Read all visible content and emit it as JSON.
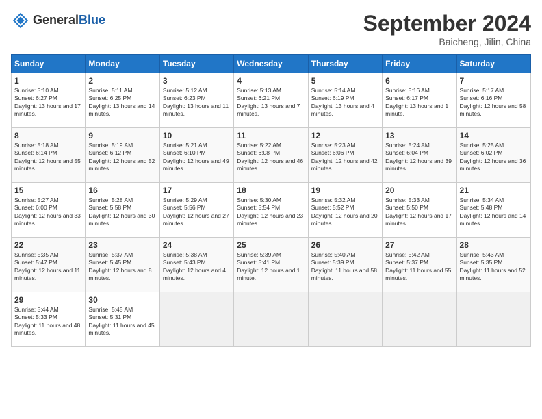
{
  "header": {
    "logo_general": "General",
    "logo_blue": "Blue",
    "month": "September 2024",
    "location": "Baicheng, Jilin, China"
  },
  "days_of_week": [
    "Sunday",
    "Monday",
    "Tuesday",
    "Wednesday",
    "Thursday",
    "Friday",
    "Saturday"
  ],
  "weeks": [
    [
      {
        "day": 1,
        "sunrise": "5:10 AM",
        "sunset": "6:27 PM",
        "daylight": "13 hours and 17 minutes."
      },
      {
        "day": 2,
        "sunrise": "5:11 AM",
        "sunset": "6:25 PM",
        "daylight": "13 hours and 14 minutes."
      },
      {
        "day": 3,
        "sunrise": "5:12 AM",
        "sunset": "6:23 PM",
        "daylight": "13 hours and 11 minutes."
      },
      {
        "day": 4,
        "sunrise": "5:13 AM",
        "sunset": "6:21 PM",
        "daylight": "13 hours and 7 minutes."
      },
      {
        "day": 5,
        "sunrise": "5:14 AM",
        "sunset": "6:19 PM",
        "daylight": "13 hours and 4 minutes."
      },
      {
        "day": 6,
        "sunrise": "5:16 AM",
        "sunset": "6:17 PM",
        "daylight": "13 hours and 1 minute."
      },
      {
        "day": 7,
        "sunrise": "5:17 AM",
        "sunset": "6:16 PM",
        "daylight": "12 hours and 58 minutes."
      }
    ],
    [
      {
        "day": 8,
        "sunrise": "5:18 AM",
        "sunset": "6:14 PM",
        "daylight": "12 hours and 55 minutes."
      },
      {
        "day": 9,
        "sunrise": "5:19 AM",
        "sunset": "6:12 PM",
        "daylight": "12 hours and 52 minutes."
      },
      {
        "day": 10,
        "sunrise": "5:21 AM",
        "sunset": "6:10 PM",
        "daylight": "12 hours and 49 minutes."
      },
      {
        "day": 11,
        "sunrise": "5:22 AM",
        "sunset": "6:08 PM",
        "daylight": "12 hours and 46 minutes."
      },
      {
        "day": 12,
        "sunrise": "5:23 AM",
        "sunset": "6:06 PM",
        "daylight": "12 hours and 42 minutes."
      },
      {
        "day": 13,
        "sunrise": "5:24 AM",
        "sunset": "6:04 PM",
        "daylight": "12 hours and 39 minutes."
      },
      {
        "day": 14,
        "sunrise": "5:25 AM",
        "sunset": "6:02 PM",
        "daylight": "12 hours and 36 minutes."
      }
    ],
    [
      {
        "day": 15,
        "sunrise": "5:27 AM",
        "sunset": "6:00 PM",
        "daylight": "12 hours and 33 minutes."
      },
      {
        "day": 16,
        "sunrise": "5:28 AM",
        "sunset": "5:58 PM",
        "daylight": "12 hours and 30 minutes."
      },
      {
        "day": 17,
        "sunrise": "5:29 AM",
        "sunset": "5:56 PM",
        "daylight": "12 hours and 27 minutes."
      },
      {
        "day": 18,
        "sunrise": "5:30 AM",
        "sunset": "5:54 PM",
        "daylight": "12 hours and 23 minutes."
      },
      {
        "day": 19,
        "sunrise": "5:32 AM",
        "sunset": "5:52 PM",
        "daylight": "12 hours and 20 minutes."
      },
      {
        "day": 20,
        "sunrise": "5:33 AM",
        "sunset": "5:50 PM",
        "daylight": "12 hours and 17 minutes."
      },
      {
        "day": 21,
        "sunrise": "5:34 AM",
        "sunset": "5:48 PM",
        "daylight": "12 hours and 14 minutes."
      }
    ],
    [
      {
        "day": 22,
        "sunrise": "5:35 AM",
        "sunset": "5:47 PM",
        "daylight": "12 hours and 11 minutes."
      },
      {
        "day": 23,
        "sunrise": "5:37 AM",
        "sunset": "5:45 PM",
        "daylight": "12 hours and 8 minutes."
      },
      {
        "day": 24,
        "sunrise": "5:38 AM",
        "sunset": "5:43 PM",
        "daylight": "12 hours and 4 minutes."
      },
      {
        "day": 25,
        "sunrise": "5:39 AM",
        "sunset": "5:41 PM",
        "daylight": "12 hours and 1 minute."
      },
      {
        "day": 26,
        "sunrise": "5:40 AM",
        "sunset": "5:39 PM",
        "daylight": "11 hours and 58 minutes."
      },
      {
        "day": 27,
        "sunrise": "5:42 AM",
        "sunset": "5:37 PM",
        "daylight": "11 hours and 55 minutes."
      },
      {
        "day": 28,
        "sunrise": "5:43 AM",
        "sunset": "5:35 PM",
        "daylight": "11 hours and 52 minutes."
      }
    ],
    [
      {
        "day": 29,
        "sunrise": "5:44 AM",
        "sunset": "5:33 PM",
        "daylight": "11 hours and 48 minutes."
      },
      {
        "day": 30,
        "sunrise": "5:45 AM",
        "sunset": "5:31 PM",
        "daylight": "11 hours and 45 minutes."
      },
      null,
      null,
      null,
      null,
      null
    ]
  ]
}
